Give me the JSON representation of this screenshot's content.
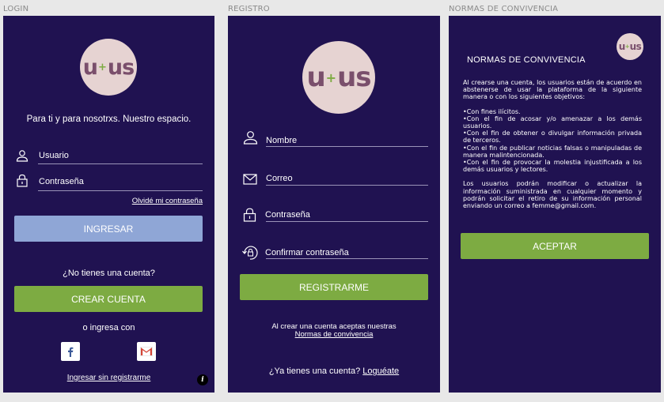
{
  "frames": {
    "login": "LOGIN",
    "registro": "REGISTRO",
    "normas": "NORMAS DE CONVIVENCIA"
  },
  "logo": {
    "left": "u",
    "plus": "+",
    "right": "us"
  },
  "login": {
    "tagline": "Para ti y para nosotrxs. Nuestro espacio.",
    "user_placeholder": "Usuario",
    "password_placeholder": "Contraseña",
    "forgot_link": "Olvidé mi contraseña",
    "login_button": "INGRESAR",
    "no_account": "¿No tienes una cuenta?",
    "create_button": "CREAR CUENTA",
    "or_login_with": "o ingresa con",
    "skip_link": "Ingresar sin registrarme",
    "info_glyph": "i"
  },
  "registro": {
    "name_placeholder": "Nombre",
    "email_placeholder": "Correo",
    "password_placeholder": "Contraseña",
    "confirm_placeholder": "Confirmar contraseña",
    "register_button": "REGISTRARME",
    "accept_text": "Al crear una cuenta aceptas nuestras",
    "rules_link": "Normas de convivencia",
    "have_account": "¿Ya tienes una cuenta?",
    "login_link": "Loguéate"
  },
  "normas": {
    "title": "NORMAS DE CONVIVENCIA",
    "intro": "Al crearse una cuenta, los usuarios están de acuerdo en abstenerse de usar la plataforma de la siguiente manera o con los siguientes objetivos:",
    "items": [
      "•Con fines ilícitos.",
      "•Con el fin de acosar y/o amenazar a los demás usuarios.",
      "•Con el fin de obtener o divulgar información privada de terceros.",
      "•Con el fin de publicar noticias falsas o manipuladas de manera malintencionada.",
      "•Con el fin de provocar la molestia injustificada a los demás usuarios y lectores."
    ],
    "outro": "Los usuarios podrán modificar o actualizar la información suministrada en cualquier momento y podrán solicitar el retiro de su información personal enviando un correo a femme@gmail.com.",
    "accept_button": "ACEPTAR"
  },
  "colors": {
    "background": "#201251",
    "green": "#7dab42",
    "blue": "#8fa6d6",
    "logo_bg": "#e6d3d2",
    "logo_text": "#7a4f6c"
  }
}
